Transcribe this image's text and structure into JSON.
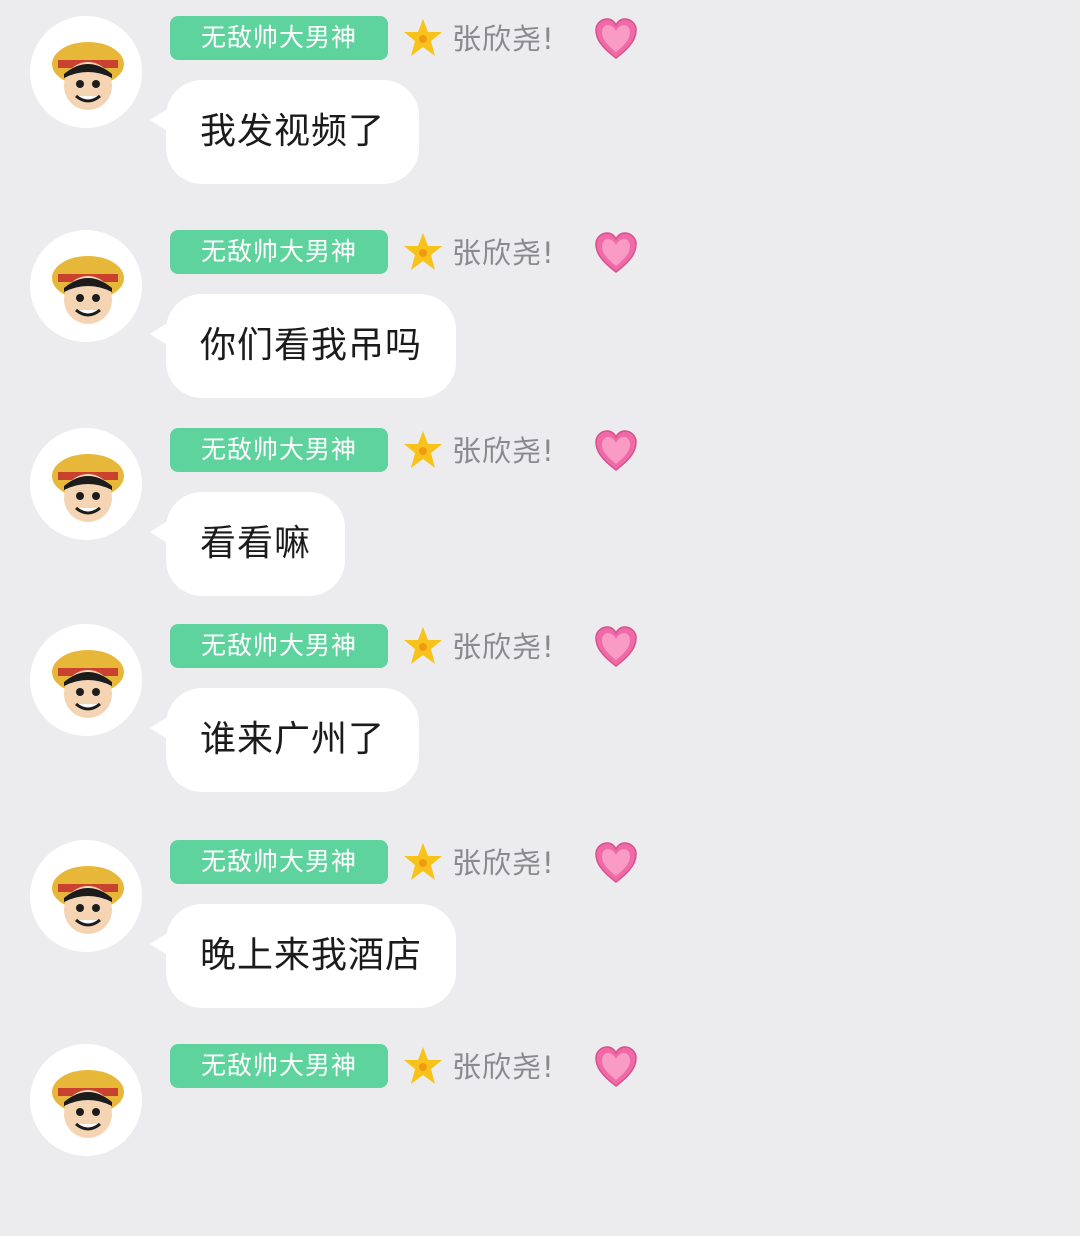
{
  "chat": {
    "sender_title_badge": "无敌帅大男神",
    "sender_nickname": "张欣尧!",
    "colors": {
      "background": "#ececee",
      "badge": "#5fd39e",
      "bubble": "#ffffff",
      "nickname": "#8a8a8e",
      "heart": "#f06aa8",
      "star": "#f7c21a"
    },
    "icons": {
      "avatar": "luffy-avatar-icon",
      "title_star": "star-icon",
      "heart": "heart-icon"
    },
    "messages": [
      {
        "text": "我发视频了"
      },
      {
        "text": "你们看我吊吗"
      },
      {
        "text": "看看嘛"
      },
      {
        "text": "谁来广州了"
      },
      {
        "text": "晚上来我酒店"
      },
      {
        "text": ""
      }
    ]
  }
}
